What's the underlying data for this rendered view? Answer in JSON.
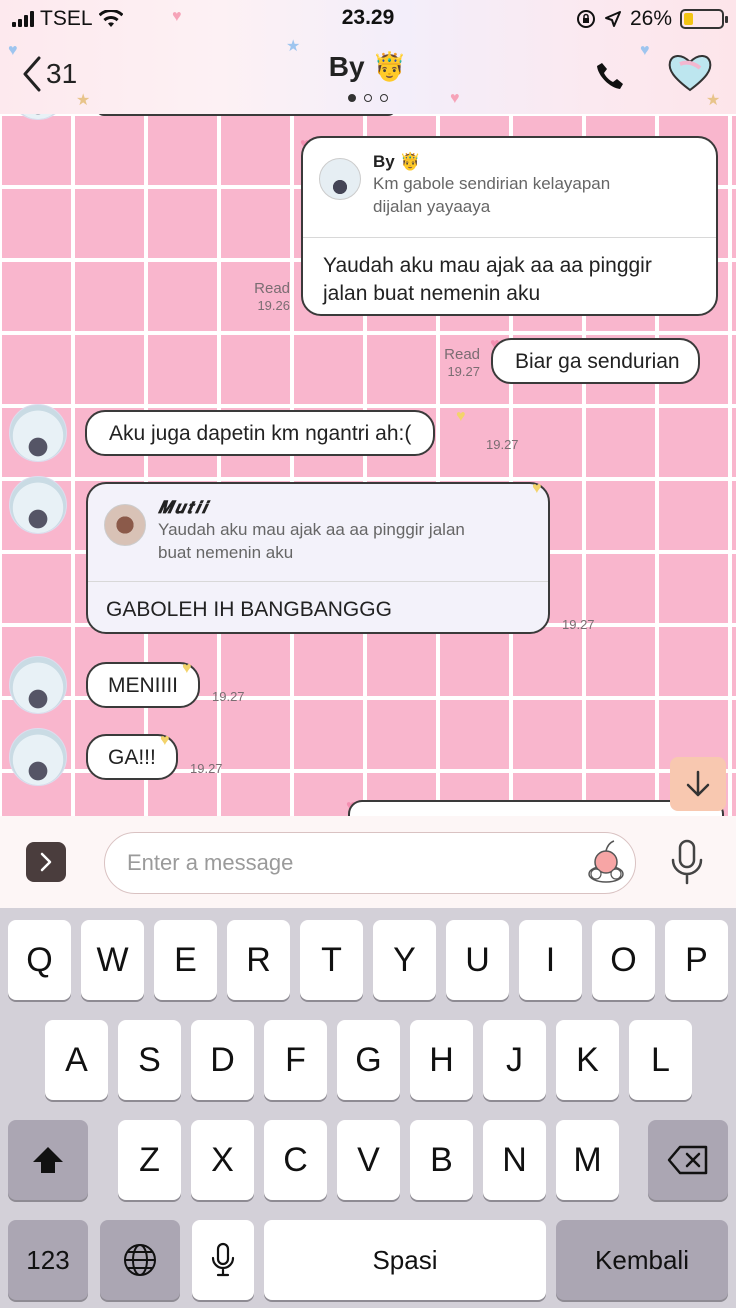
{
  "status_bar": {
    "carrier": "TSEL",
    "time": "23.29",
    "battery_percent": "26%",
    "battery_level": 0.26
  },
  "header": {
    "back_count": "31",
    "title": "By 🤴",
    "page_dots": 3,
    "active_dot": 0
  },
  "messages": {
    "m1": {
      "quote_name": "By 🤴",
      "quote_text_1": "Km gabole sendirian kelayapan",
      "quote_text_2": "dijalan yayaaya",
      "reply_1": "Yaudah aku mau ajak aa aa pinggir",
      "reply_2": "jalan buat nemenin aku",
      "read": "Read",
      "time": "19.26"
    },
    "m2": {
      "text": "Biar ga sendurian",
      "read": "Read",
      "time": "19.27"
    },
    "m3": {
      "text": "Aku juga dapetin km ngantri ah:(",
      "time": "19.27"
    },
    "m4": {
      "quote_name": "𝑴𝒖𝒕𝒊𝒊",
      "quote_text_1": "Yaudah aku mau ajak aa aa pinggir jalan",
      "quote_text_2": "buat nemenin aku",
      "reply": "GABOLEH IH BANGBANGGG",
      "time": "19.27"
    },
    "m5": {
      "text": "MENIIII",
      "time": "19.27"
    },
    "m6": {
      "text": "GA!!!",
      "time": "19.27"
    }
  },
  "composer": {
    "placeholder": "Enter a message"
  },
  "keyboard": {
    "row1": [
      "Q",
      "W",
      "E",
      "R",
      "T",
      "Y",
      "U",
      "I",
      "O",
      "P"
    ],
    "row2": [
      "A",
      "S",
      "D",
      "F",
      "G",
      "H",
      "J",
      "K",
      "L"
    ],
    "row3": [
      "Z",
      "X",
      "C",
      "V",
      "B",
      "N",
      "M"
    ],
    "numbers": "123",
    "space": "Spasi",
    "return": "Kembali"
  },
  "colors": {
    "chat_bg": "#f9b6cd",
    "grid": "#ffffff",
    "keyboard_bg": "#d3d0d8"
  }
}
